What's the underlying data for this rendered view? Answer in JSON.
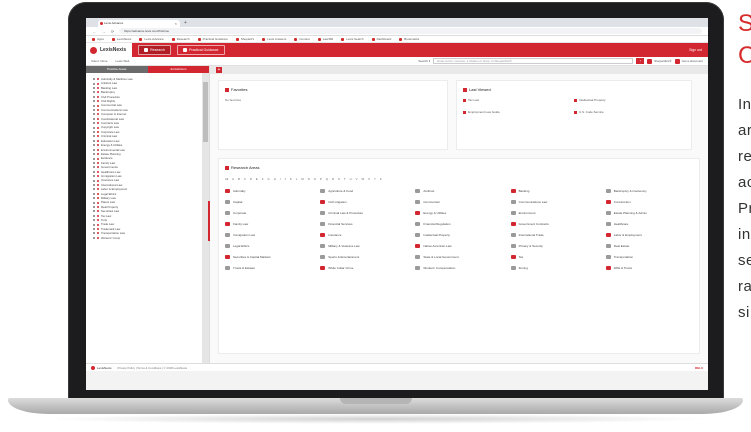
{
  "browser": {
    "tab_title": "Lexis Advance",
    "tab_close": "×",
    "new_tab": "+",
    "url": "https://advance.lexis.com/firsttime",
    "nav": [
      "←",
      "→",
      "⟳"
    ],
    "bookmarks": [
      "Apps",
      "LexisNexis",
      "Lexis Advance",
      "Research",
      "Practical Guidance",
      "Shepard's",
      "Lexis Answers",
      "Context",
      "Law360",
      "Lexis Search",
      "Dashboard",
      "Bookmarks"
    ]
  },
  "app": {
    "logo": "LexisNexis",
    "tabs": [
      "Research",
      "Practical Guidance"
    ],
    "user": "Sign out",
    "sub_links": [
      "Client: None",
      "Lexis Web"
    ],
    "search_scope": "Search ▾",
    "search_placeholder": "Enter terms, sources, a citation or shep: to Shepardize®",
    "search_button": "›",
    "right_links": [
      "Shepardize®",
      "Get a document"
    ]
  },
  "sidebar": {
    "tabs": [
      "Practice Areas",
      "Jurisdictions"
    ],
    "items": [
      "Admiralty & Maritime Law",
      "Antitrust Law",
      "Banking Law",
      "Bankruptcy",
      "Civil Procedure",
      "Civil Rights",
      "Commercial Law",
      "Communications Law",
      "Computer & Internet",
      "Constitutional Law",
      "Contracts Law",
      "Copyright Law",
      "Corporate Law",
      "Criminal Law",
      "Education Law",
      "Energy & Utilities",
      "Environmental Law",
      "Estate Planning",
      "Evidence",
      "Family Law",
      "Governments",
      "Healthcare Law",
      "Immigration Law",
      "Insurance Law",
      "International Law",
      "Labor & Employment",
      "Legal Ethics",
      "Military Law",
      "Patent Law",
      "Real Property",
      "Securities Law",
      "Tax Law",
      "Torts",
      "Trade Law",
      "Trademark Law",
      "Transportation Law",
      "Workers' Comp"
    ]
  },
  "main": {
    "favorites_title": "Favorites",
    "favorites_text": "No favorites",
    "last_viewed_title": "Last Viewed",
    "last_viewed": [
      "Tax Law",
      "Intellectual Property",
      "Employment Law Guide",
      "U.S. Code Service"
    ],
    "research_title": "Research Areas",
    "alphabet": [
      "All",
      "A",
      "B",
      "C",
      "D",
      "E",
      "F",
      "G",
      "H",
      "I",
      "J",
      "K",
      "L",
      "M",
      "N",
      "O",
      "P",
      "Q",
      "R",
      "S",
      "T",
      "U",
      "V",
      "W",
      "X",
      "Y",
      "Z"
    ],
    "research_items": [
      "Admiralty",
      "Agriculture & Food",
      "Antitrust",
      "Banking",
      "Bankruptcy & Insolvency",
      "Capital",
      "Civil Litigation",
      "Commercial",
      "Communications Law",
      "Construction",
      "Corporate",
      "Criminal Law & Procedure",
      "Energy & Utilities",
      "Environment",
      "Estate Planning & Admin",
      "Family Law",
      "Financial Services",
      "Financial Regulation",
      "Government Contracts",
      "Healthcare",
      "Immigration Law",
      "Insurance",
      "Intellectual Property",
      "International Trade",
      "Labor & Employment",
      "Legal Ethics",
      "Military & Veterans Law",
      "Native American Law",
      "Privacy & Security",
      "Real Estate",
      "Securities & Capital Markets",
      "Sports & Entertainment",
      "State & Local Government",
      "Tax",
      "Transportation",
      "Trusts & Estates",
      "White Collar Crime",
      "Workers' Compensation",
      "Zoning",
      "Wills & Trusts"
    ]
  },
  "statusbar": {
    "logo": "LexisNexis",
    "text": "Privacy Policy | Terms & Conditions | © 2018 LexisNexis",
    "brand": "RELX"
  },
  "copy": {
    "heading_lines": [
      "S",
      "C"
    ],
    "para_lines": [
      "In",
      "ar",
      "re",
      "ac",
      "Pr",
      "in",
      "se",
      "ra",
      "si"
    ]
  },
  "colors": {
    "brand": "#d22630",
    "heading": "#d62b2b"
  }
}
